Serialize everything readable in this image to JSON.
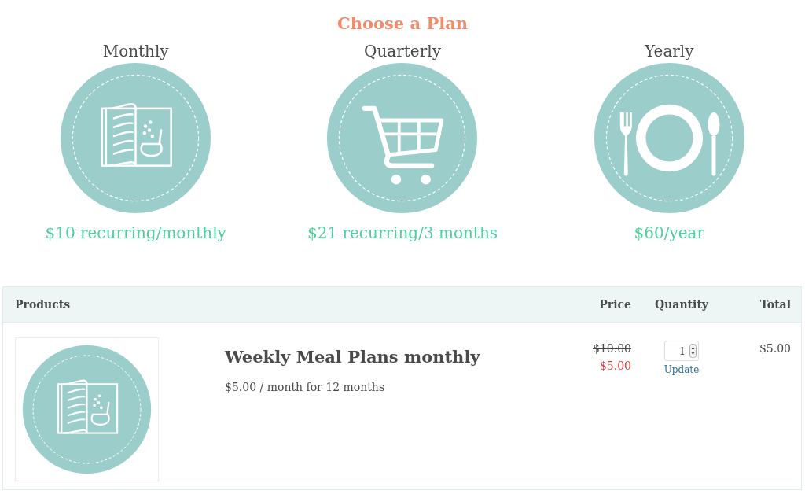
{
  "heading": "Choose a Plan",
  "plans": [
    {
      "name": "Monthly",
      "kind": "book",
      "price": "$10 recurring/monthly"
    },
    {
      "name": "Quarterly",
      "kind": "cart",
      "price": "$21 recurring/3 months"
    },
    {
      "name": "Yearly",
      "kind": "plate",
      "price": "$60/year"
    }
  ],
  "table": {
    "columns": [
      "Products",
      "Price",
      "Quantity",
      "Total"
    ],
    "rows": [
      {
        "kind": "book",
        "title": "Weekly Meal Plans monthly",
        "subtitle": "$5.00 / month for 12 months",
        "regular_price": "$10.00",
        "sale_price": "$5.00",
        "quantity": "1",
        "update": "Update",
        "total": "$5.00"
      }
    ]
  }
}
